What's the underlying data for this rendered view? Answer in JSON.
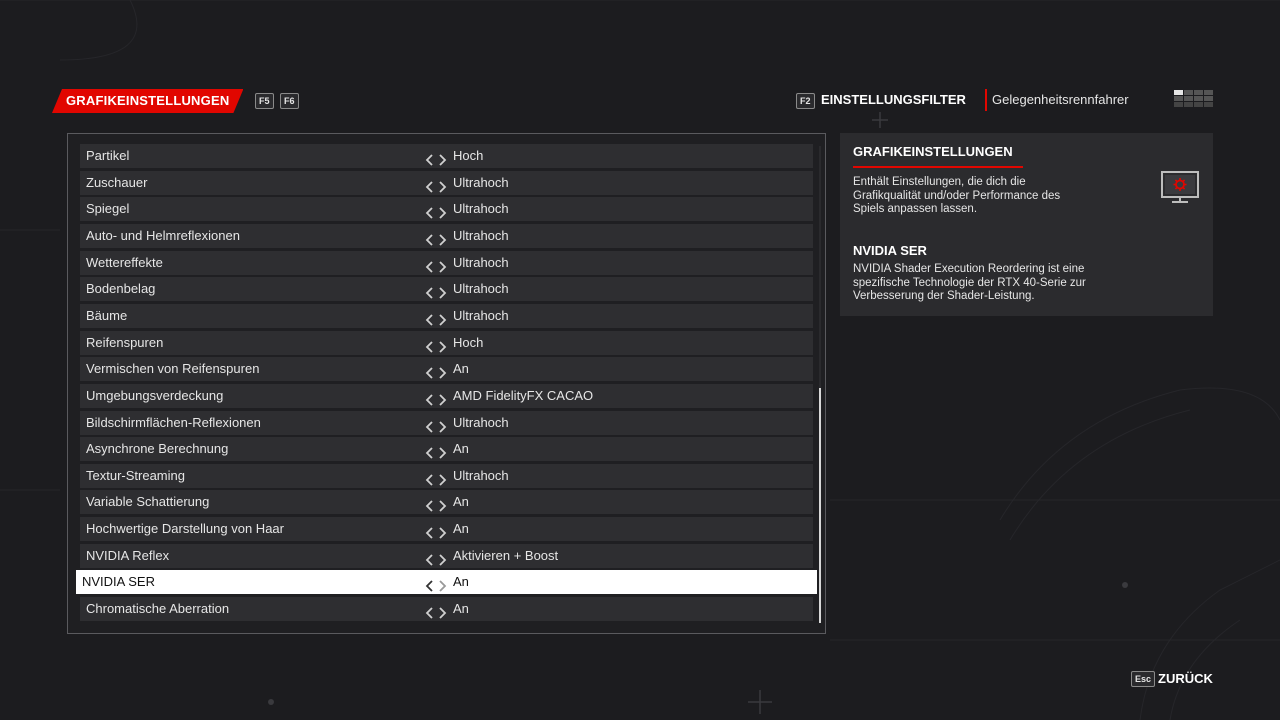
{
  "header": {
    "title": "GRAFIKEINSTELLUNGEN",
    "key_prev": "F5",
    "key_next": "F6",
    "filter_key": "F2",
    "filter_label": "EINSTELLUNGSFILTER",
    "filter_value": "Gelegenheitsrennfahrer"
  },
  "settings": [
    {
      "label": "Partikel",
      "value": "Hoch"
    },
    {
      "label": "Zuschauer",
      "value": "Ultrahoch"
    },
    {
      "label": "Spiegel",
      "value": "Ultrahoch"
    },
    {
      "label": "Auto- und Helmreflexionen",
      "value": "Ultrahoch"
    },
    {
      "label": "Wettereffekte",
      "value": "Ultrahoch"
    },
    {
      "label": "Bodenbelag",
      "value": "Ultrahoch"
    },
    {
      "label": "Bäume",
      "value": "Ultrahoch"
    },
    {
      "label": "Reifenspuren",
      "value": "Hoch"
    },
    {
      "label": "Vermischen von Reifenspuren",
      "value": "An"
    },
    {
      "label": "Umgebungsverdeckung",
      "value": "AMD FidelityFX CACAO"
    },
    {
      "label": "Bildschirmflächen-Reflexionen",
      "value": "Ultrahoch"
    },
    {
      "label": "Asynchrone Berechnung",
      "value": "An"
    },
    {
      "label": "Textur-Streaming",
      "value": "Ultrahoch"
    },
    {
      "label": "Variable Schattierung",
      "value": "An"
    },
    {
      "label": "Hochwertige Darstellung von Haar",
      "value": "An"
    },
    {
      "label": "NVIDIA Reflex",
      "value": "Aktivieren + Boost"
    },
    {
      "label": "NVIDIA SER",
      "value": "An"
    },
    {
      "label": "Chromatische Aberration",
      "value": "An"
    }
  ],
  "selected_index": 16,
  "info": {
    "section_title": "GRAFIKEINSTELLUNGEN",
    "section_lines": [
      "Enthält Einstellungen, die dich die",
      "Grafikqualität und/oder Performance des",
      "Spiels anpassen lassen."
    ],
    "option_title": "NVIDIA SER",
    "option_lines": [
      "NVIDIA Shader Execution Reordering ist eine",
      "spezifische Technologie der RTX 40-Serie zur",
      "Verbesserung der Shader-Leistung."
    ],
    "icon": "monitor-gear-icon"
  },
  "footer": {
    "back_key": "Esc",
    "back_label": "ZURÜCK"
  },
  "colors": {
    "accent": "#e10600",
    "background": "#1c1c1f",
    "row": "#2e2e31",
    "selected_row": "#ffffff"
  }
}
